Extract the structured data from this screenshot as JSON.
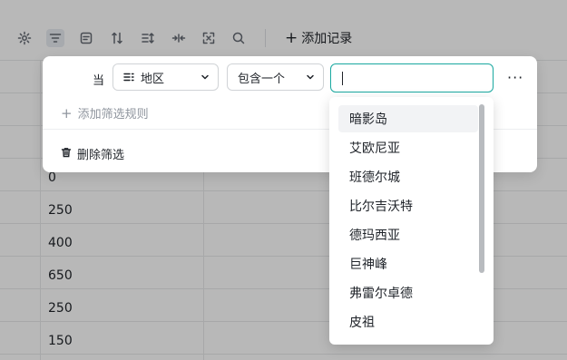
{
  "toolbar": {
    "add_record_label": "添加记录",
    "icons": [
      "gear-icon",
      "filter-icon",
      "card-icon",
      "sort-icon",
      "group-icon",
      "collapse-icon",
      "expand-icon",
      "search-icon"
    ]
  },
  "grid": {
    "cells": [
      "0",
      "250",
      "400",
      "650",
      "250",
      "150"
    ]
  },
  "filter": {
    "when_label": "当",
    "field_value": "地区",
    "operator_value": "包含一个",
    "value_input": "",
    "more_label": "···",
    "add_rule_label": "添加筛选规则",
    "delete_label": "删除筛选"
  },
  "dropdown": {
    "options": [
      "暗影岛",
      "艾欧尼亚",
      "班德尔城",
      "比尔吉沃特",
      "德玛西亚",
      "巨神峰",
      "弗雷尔卓德",
      "皮祖"
    ]
  },
  "colors": {
    "accent": "#19a8a0",
    "overlay": "rgba(0,0,0,0.28)"
  }
}
